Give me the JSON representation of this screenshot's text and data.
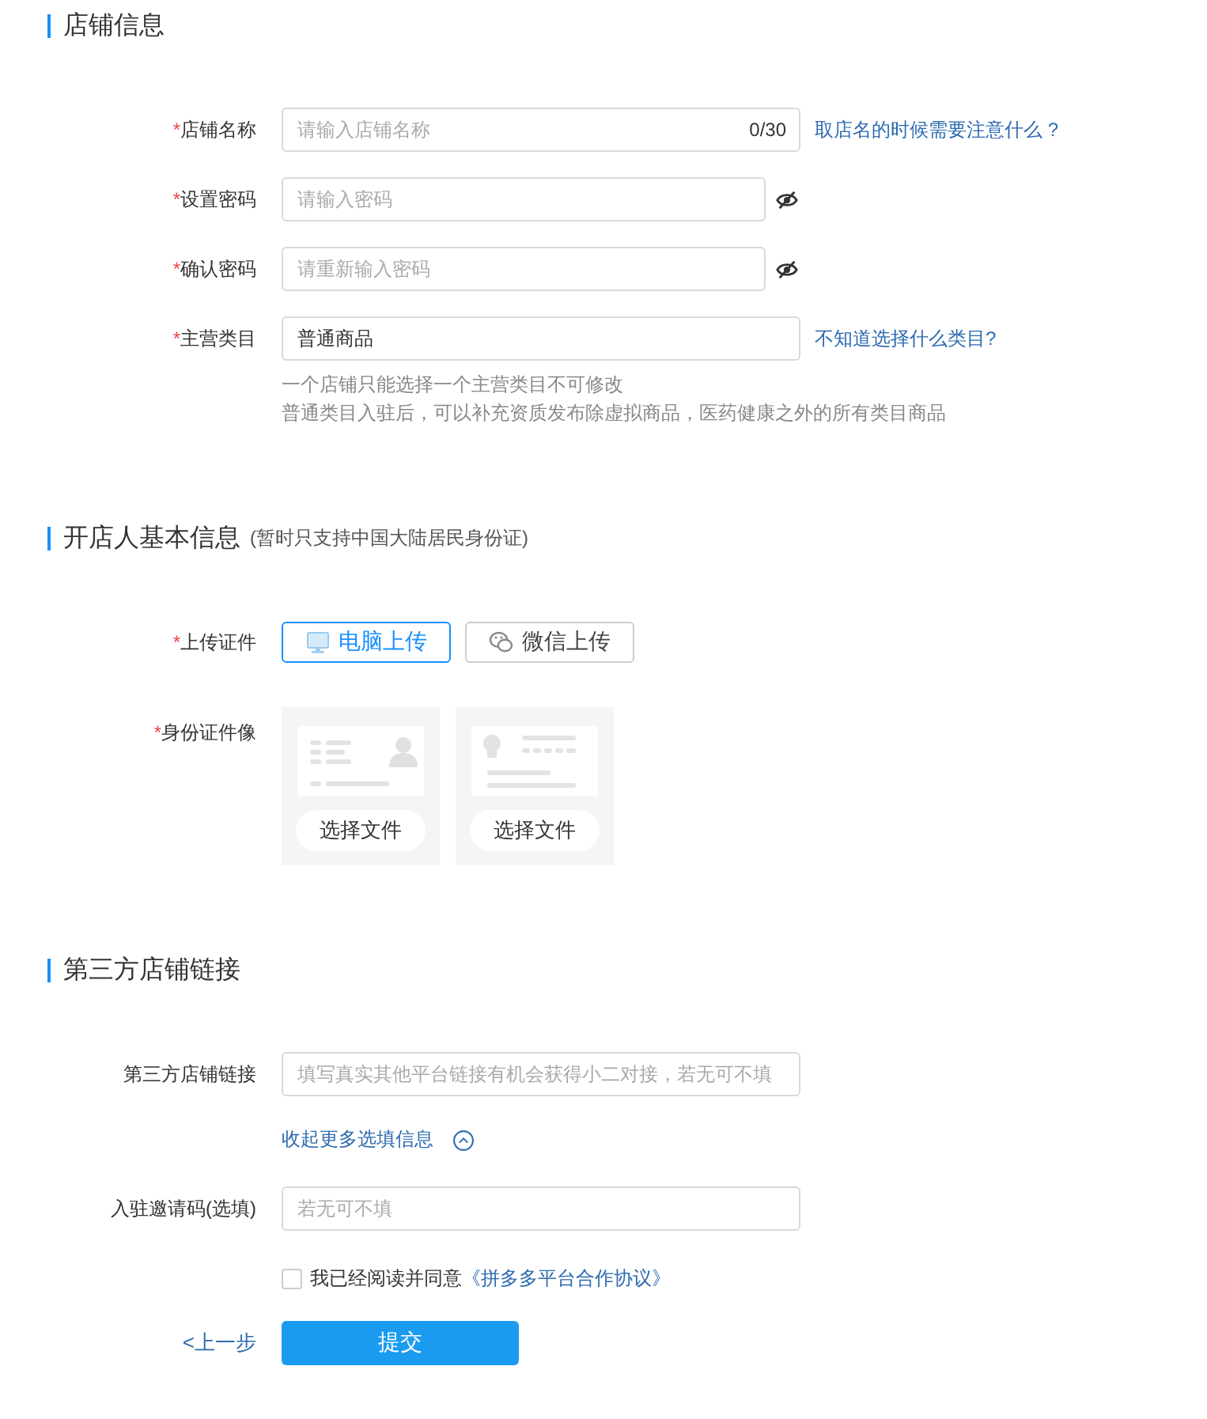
{
  "store_info": {
    "title": "店铺信息",
    "fields": [
      {
        "kind": "text",
        "required_mark": "*",
        "label": "店铺名称",
        "placeholder": "请输入店铺名称",
        "counter": "0/30",
        "link": "取店名的时候需要注意什么 ?"
      },
      {
        "kind": "password",
        "required_mark": "*",
        "label": "设置密码",
        "placeholder": "请输入密码"
      },
      {
        "kind": "password",
        "required_mark": "*",
        "label": "确认密码",
        "placeholder": "请重新输入密码"
      },
      {
        "kind": "text",
        "required_mark": "*",
        "label": "主营类目",
        "value": "普通商品",
        "link": "不知道选择什么类目?",
        "hints": [
          "一个店铺只能选择一个主营类目不可修改",
          "普通类目入驻后，可以补充资质发布除虚拟商品，医药健康之外的所有类目商品"
        ]
      }
    ]
  },
  "owner_info": {
    "title": "开店人基本信息",
    "note": "(暂时只支持中国大陆居民身份证)",
    "upload": {
      "required_mark": "*",
      "label": "上传证件",
      "options": [
        {
          "kind": "computer",
          "label": "电脑上传",
          "selected": true
        },
        {
          "kind": "wechat",
          "label": "微信上传",
          "selected": false
        }
      ]
    },
    "id_photos": {
      "required_mark": "*",
      "label": "身份证件像",
      "cards": [
        {
          "kind": "front",
          "button": "选择文件"
        },
        {
          "kind": "back",
          "button": "选择文件"
        }
      ]
    }
  },
  "third_party": {
    "title": "第三方店铺链接",
    "link_field": {
      "label": "第三方店铺链接",
      "placeholder": "填写真实其他平台链接有机会获得小二对接，若无可不填"
    },
    "toggle": {
      "label": "收起更多选填信息",
      "expanded": true
    },
    "invite_field": {
      "label": "入驻邀请码(选填)",
      "placeholder": "若无可不填"
    }
  },
  "agreement": {
    "checked": false,
    "text": "我已经阅读并同意",
    "link": "《拼多多平台合作协议》"
  },
  "back_link": "<上一步",
  "submit": "提交"
}
